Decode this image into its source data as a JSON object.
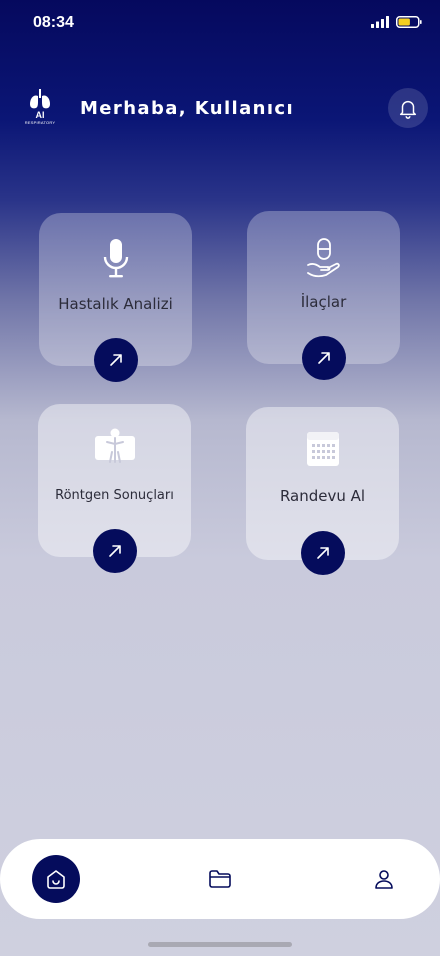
{
  "status_bar": {
    "time": "08:34",
    "battery_level": 0.6
  },
  "header": {
    "logo_text": "AI",
    "logo_subtext": "RESPIRATORY",
    "greeting": "Merhaba, Kullanıcı"
  },
  "cards": [
    {
      "label": "Hastalık Analizi",
      "icon": "microphone-icon"
    },
    {
      "label": "İlaçlar",
      "icon": "pill-hand-icon"
    },
    {
      "label": "Röntgen Sonuçları",
      "icon": "xray-person-icon"
    },
    {
      "label": "Randevu Al",
      "icon": "calendar-icon"
    }
  ],
  "nav": {
    "items": [
      "home-icon",
      "folder-icon",
      "profile-icon"
    ],
    "active": "home-icon"
  },
  "colors": {
    "accent": "#050c5c",
    "header_bg": "#05095e",
    "card_text": "#2c2c3a"
  }
}
